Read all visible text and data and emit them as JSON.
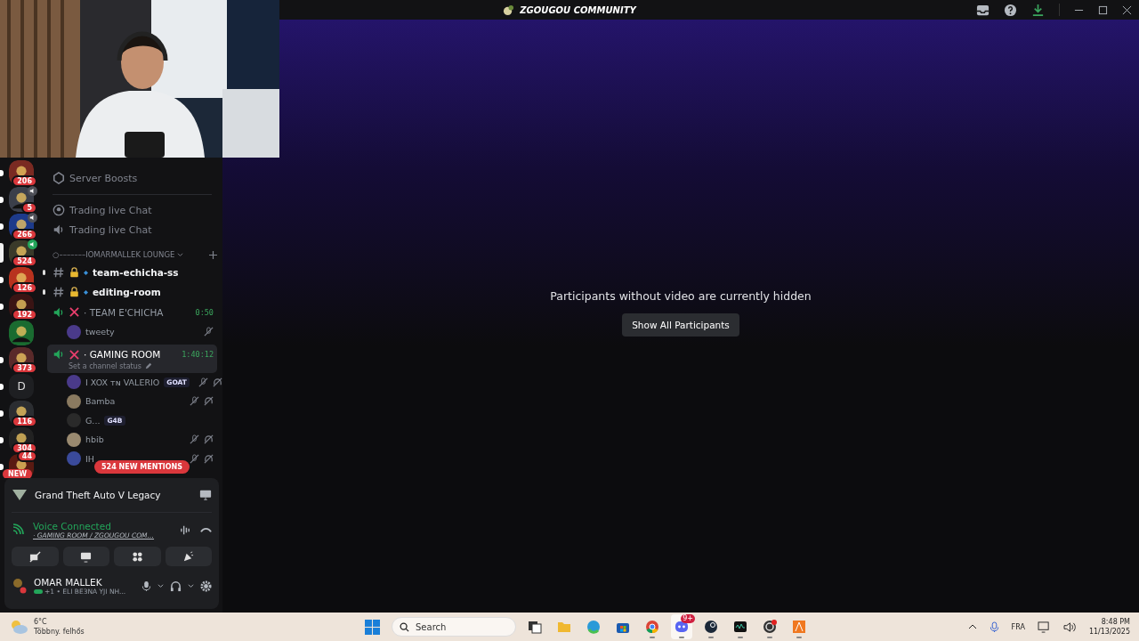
{
  "window": {
    "title": "ZGOUGOU COMMUNITY"
  },
  "servers": [
    {
      "badge": "206",
      "unread": true,
      "selected": false
    },
    {
      "badge": "5",
      "speaking": false,
      "unread": true,
      "selected": false
    },
    {
      "badge": "266",
      "speaking": false,
      "unread": true,
      "selected": false
    },
    {
      "badge": "524",
      "speaking": true,
      "unread": false,
      "selected": true
    },
    {
      "badge": "126",
      "unread": true,
      "selected": false
    },
    {
      "badge": "192",
      "unread": true,
      "selected": false
    },
    {
      "unread": false,
      "selected": false
    },
    {
      "badge": "373",
      "unread": true,
      "selected": false
    },
    {
      "label": "D",
      "unread": true,
      "selected": false
    },
    {
      "badge": "116",
      "unread": true,
      "selected": false
    },
    {
      "badge": "304",
      "unread": true,
      "selected": false
    },
    {
      "badge": "44",
      "pill": "NEW",
      "unread": true,
      "selected": false
    }
  ],
  "server_menu": [
    "Server Boosts"
  ],
  "channels": [
    {
      "kind": "stage",
      "name": "Trading live Chat"
    },
    {
      "kind": "voice",
      "name": "Trading live Chat"
    }
  ],
  "category": {
    "name": "○–––––––IOMARMALLEK LOUNGE"
  },
  "lounge": [
    {
      "kind": "text",
      "name": "team-echicha-ss",
      "locked": true,
      "unread": true
    },
    {
      "kind": "text",
      "name": "editing-room",
      "locked": true,
      "unread": true
    },
    {
      "kind": "room",
      "name": "· TEAM E'CHICHA",
      "timer": "0:50",
      "selected": false,
      "users": [
        {
          "name": "tweety",
          "muted": true,
          "deafened": false
        }
      ]
    },
    {
      "kind": "room",
      "name": "· GAMING ROOM",
      "timer": "1:40:12",
      "selected": true,
      "status": "Set a channel status",
      "users": [
        {
          "name": "I XOX ᴛɴ VALERIO",
          "tag": "GOAT",
          "muted": true,
          "deafened": true
        },
        {
          "name": "Bamba",
          "muted": true,
          "deafened": true
        },
        {
          "name": "G...",
          "tag": "G4B",
          "muted": false,
          "deafened": false
        },
        {
          "name": "hbib",
          "muted": true,
          "deafened": true
        },
        {
          "name": "IH",
          "muted": true,
          "deafened": true
        }
      ]
    }
  ],
  "mentions_pill": "524 NEW MENTIONS",
  "activity": {
    "title": "Grand Theft Auto V Legacy"
  },
  "voice": {
    "status": "Voice Connected",
    "channel": "· GAMING ROOM / ZGOUGOU COM…"
  },
  "user": {
    "name": "OMAR MALLEK",
    "status": "+1 • ELI BE3NA YJI NH..."
  },
  "main": {
    "notice": "Participants without video are currently hidden",
    "button": "Show All Participants"
  },
  "taskbar": {
    "temp": "6°C",
    "weather": "Többny. felhős",
    "search": {
      "placeholder": "Search"
    },
    "apps": [
      {
        "kind": "taskview",
        "running": false,
        "selected": false
      },
      {
        "kind": "files",
        "running": false,
        "selected": false
      },
      {
        "kind": "edge",
        "running": false,
        "selected": false
      },
      {
        "kind": "store",
        "running": false,
        "selected": false
      },
      {
        "kind": "chrome",
        "running": true,
        "selected": false
      },
      {
        "kind": "discord",
        "running": true,
        "selected": true,
        "badge": "9+"
      },
      {
        "kind": "steam",
        "running": true,
        "selected": false
      },
      {
        "kind": "terminal",
        "running": true,
        "selected": false
      },
      {
        "kind": "obs",
        "running": true,
        "selected": false
      },
      {
        "kind": "editor",
        "running": true,
        "selected": false
      }
    ],
    "lang": "FRA",
    "time": "8:48 PM",
    "date": "11/13/2025"
  }
}
